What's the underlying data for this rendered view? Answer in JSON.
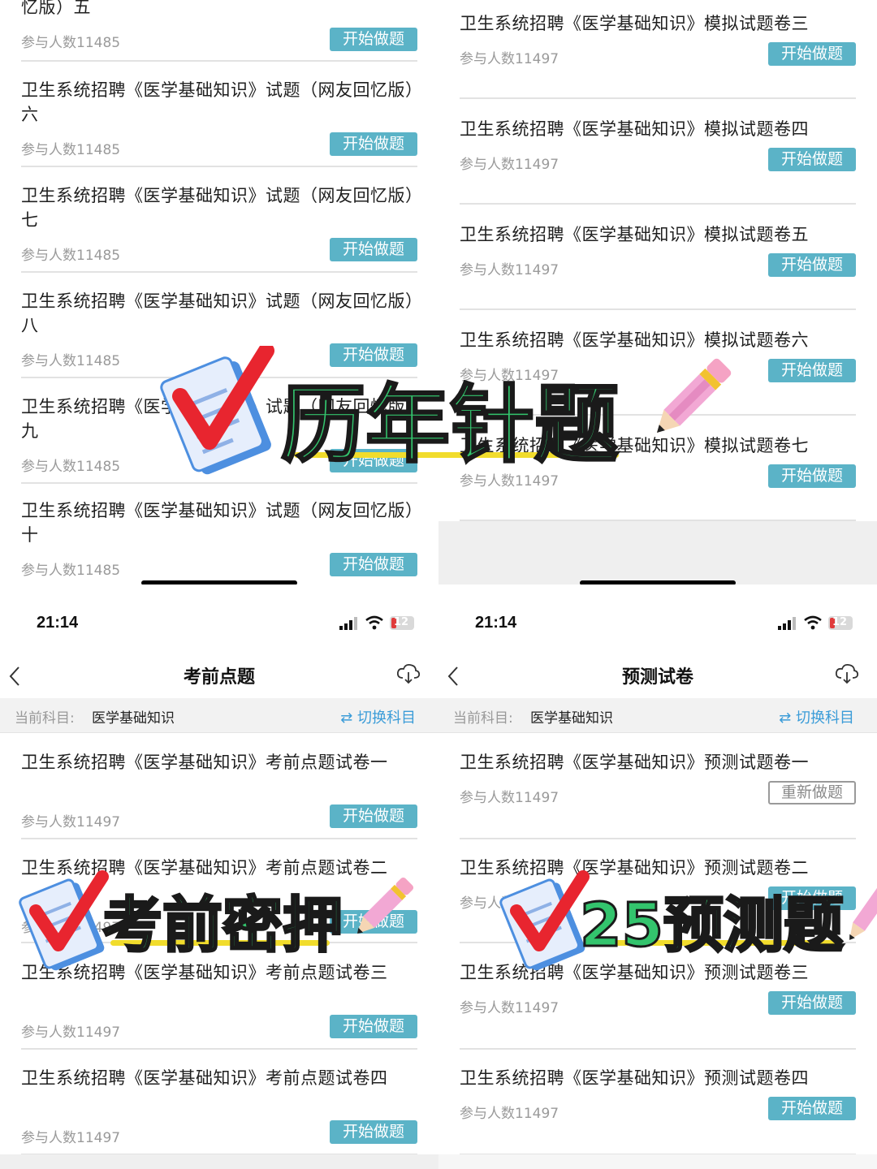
{
  "top_left": {
    "items": [
      {
        "title": "忆版）五",
        "count": "参与人数11485",
        "btn": "开始做题"
      },
      {
        "title": "卫生系统招聘《医学基础知识》试题（网友回忆版）六",
        "count": "参与人数11485",
        "btn": "开始做题"
      },
      {
        "title": "卫生系统招聘《医学基础知识》试题（网友回忆版）七",
        "count": "参与人数11485",
        "btn": "开始做题"
      },
      {
        "title": "卫生系统招聘《医学基础知识》试题（网友回忆版）八",
        "count": "参与人数11485",
        "btn": "开始做题"
      },
      {
        "title": "卫生系统招聘《医学基础知识》试题（网友回忆版）九",
        "count": "参与人数11485",
        "btn": "开始做题"
      },
      {
        "title": "卫生系统招聘《医学基础知识》试题（网友回忆版）十",
        "count": "参与人数11485",
        "btn": "开始做题"
      }
    ]
  },
  "top_right": {
    "items": [
      {
        "title": "卫生系统招聘《医学基础知识》模拟试题卷三",
        "count": "参与人数11497",
        "btn": "开始做题"
      },
      {
        "title": "卫生系统招聘《医学基础知识》模拟试题卷四",
        "count": "参与人数11497",
        "btn": "开始做题"
      },
      {
        "title": "卫生系统招聘《医学基础知识》模拟试题卷五",
        "count": "参与人数11497",
        "btn": "开始做题"
      },
      {
        "title": "卫生系统招聘《医学基础知识》模拟试题卷六",
        "count": "参与人数11497",
        "btn": "开始做题"
      },
      {
        "title": "卫生系统招聘《医学基础知识》模拟试题卷七",
        "count": "参与人数11497",
        "btn": "开始做题"
      }
    ]
  },
  "bottom_left": {
    "time": "21:14",
    "battery": "12",
    "nav_title": "考前点题",
    "subject_label": "当前科目:",
    "subject_value": "医学基础知识",
    "switch_label": "⇄ 切换科目",
    "items": [
      {
        "title": "卫生系统招聘《医学基础知识》考前点题试卷一",
        "count": "参与人数11497",
        "btn": "开始做题"
      },
      {
        "title": "卫生系统招聘《医学基础知识》考前点题试卷二",
        "count": "参与人数11497",
        "btn": "开始做题"
      },
      {
        "title": "卫生系统招聘《医学基础知识》考前点题试卷三",
        "count": "参与人数11497",
        "btn": "开始做题"
      },
      {
        "title": "卫生系统招聘《医学基础知识》考前点题试卷四",
        "count": "参与人数11497",
        "btn": "开始做题"
      }
    ]
  },
  "bottom_right": {
    "time": "21:14",
    "battery": "12",
    "nav_title": "预测试卷",
    "subject_label": "当前科目:",
    "subject_value": "医学基础知识",
    "switch_label": "⇄ 切换科目",
    "items": [
      {
        "title": "卫生系统招聘《医学基础知识》预测试题卷一",
        "count": "参与人数11497",
        "btn": "重新做题"
      },
      {
        "title": "卫生系统招聘《医学基础知识》预测试题卷二",
        "count": "参与人数11497",
        "btn": "开始做题"
      },
      {
        "title": "卫生系统招聘《医学基础知识》预测试题卷三",
        "count": "参与人数11497",
        "btn": "开始做题"
      },
      {
        "title": "卫生系统招聘《医学基础知识》预测试题卷四",
        "count": "参与人数11497",
        "btn": "开始做题"
      }
    ]
  },
  "overlays": {
    "main": "历年针题",
    "exam": "考前密押",
    "predict": "25预测题"
  },
  "colors": {
    "button": "#5bb3c7",
    "link": "#3b9cd8",
    "overlay_text": "#33c46d",
    "underline": "#f1dc2c"
  },
  "icons": [
    "back-chevron-icon",
    "cloud-download-icon",
    "signal-icon",
    "wifi-icon",
    "battery-icon",
    "checkmark-document-icon",
    "pencil-icon"
  ]
}
